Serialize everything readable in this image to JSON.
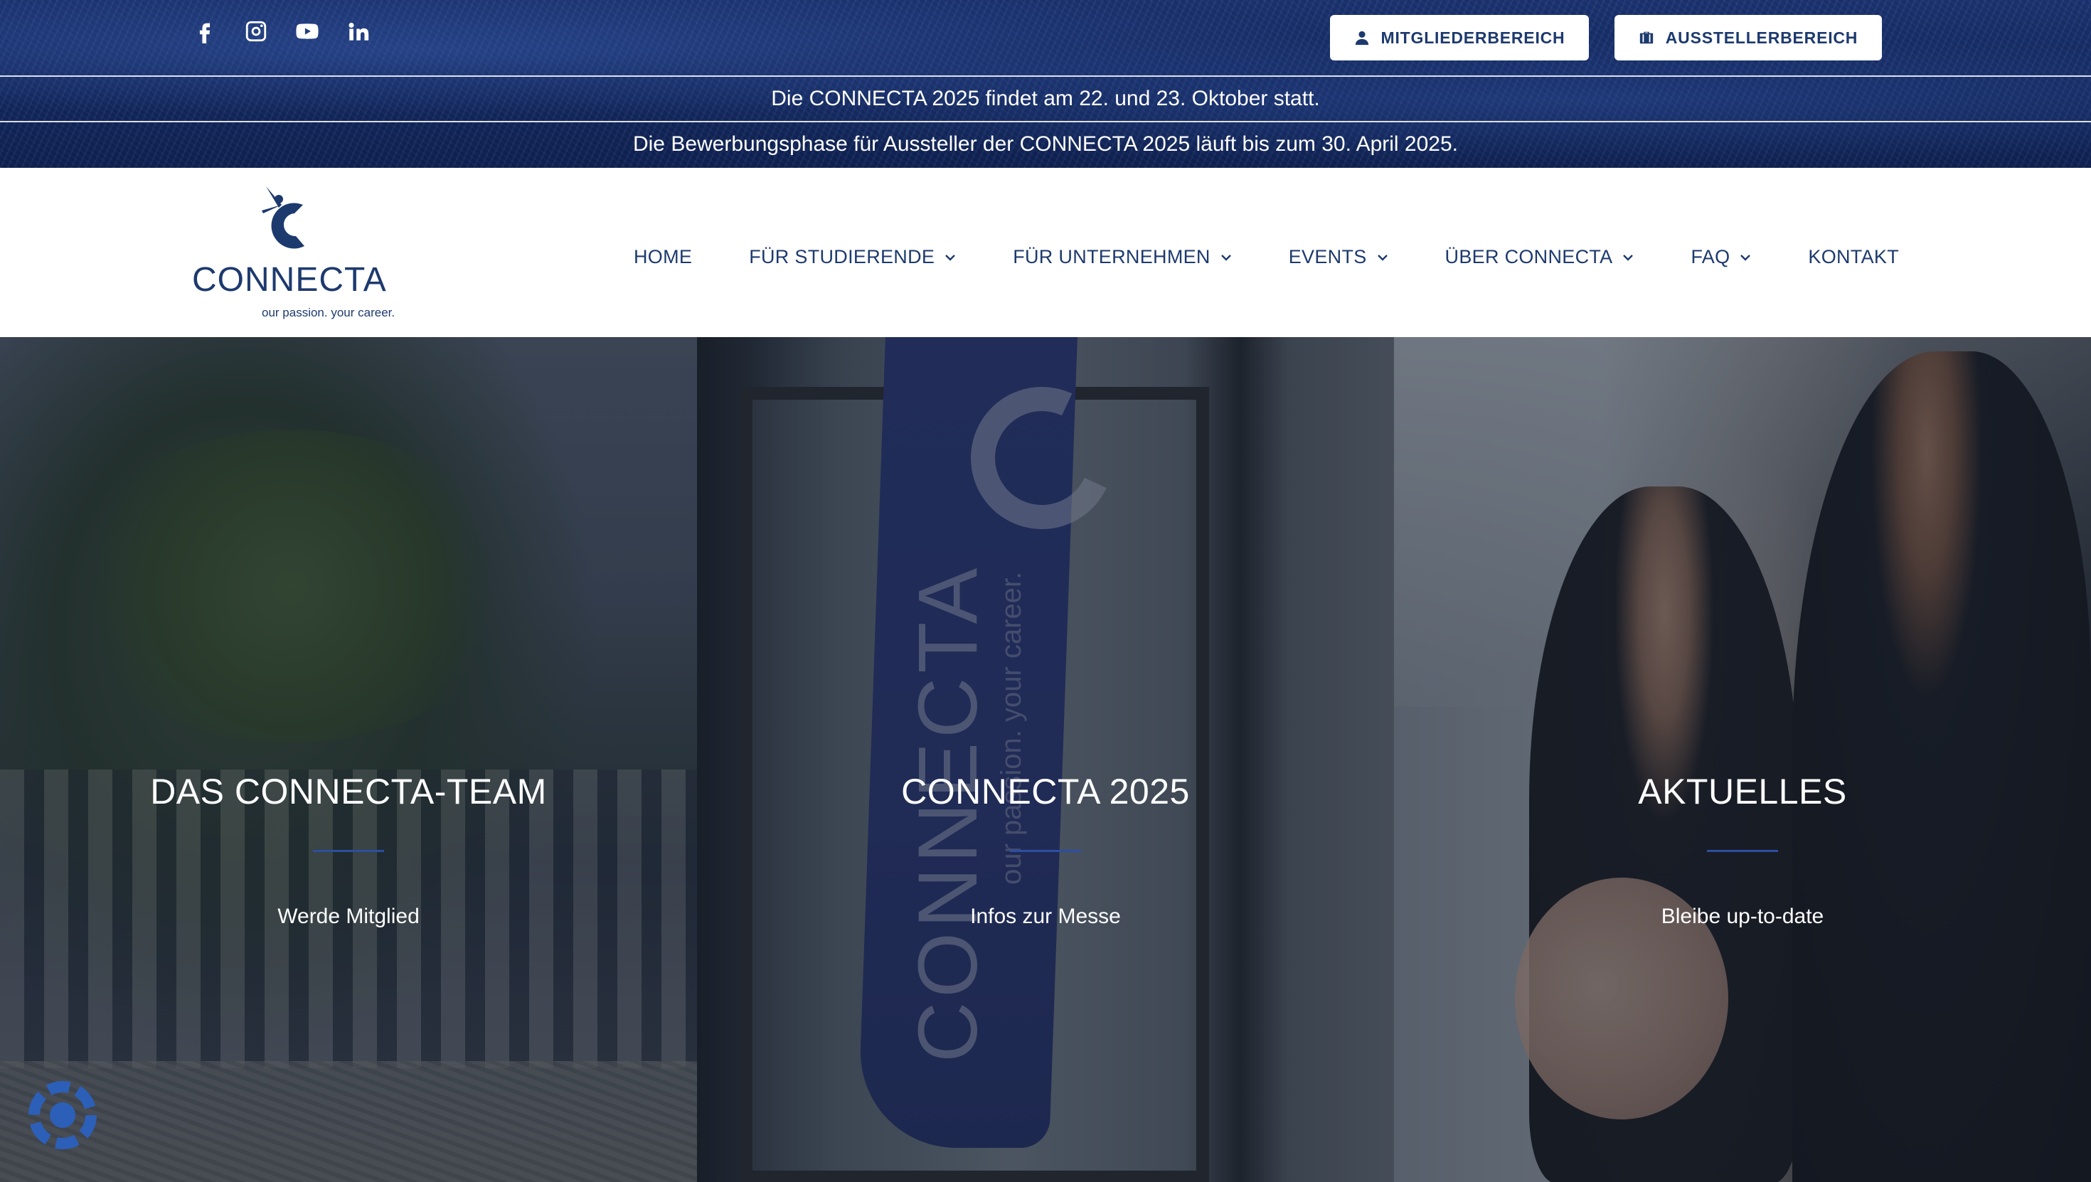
{
  "social": {
    "icons": [
      "facebook-icon",
      "instagram-icon",
      "youtube-icon",
      "linkedin-icon"
    ]
  },
  "top_buttons": {
    "members": {
      "label": "MITGLIEDERBEREICH",
      "icon": "user-icon"
    },
    "exhibitors": {
      "label": "AUSSTELLERBEREICH",
      "icon": "briefcase-icon"
    }
  },
  "notices": [
    "Die CONNECTA 2025 findet am 22. und 23. Oktober statt.",
    "Die Bewerbungsphase für Aussteller der CONNECTA 2025 läuft bis zum 30. April 2025."
  ],
  "logo": {
    "wordmark": "CONNECTA",
    "tagline": "our passion. your career."
  },
  "nav": {
    "items": [
      {
        "label": "HOME",
        "dropdown": false
      },
      {
        "label": "FÜR STUDIERENDE",
        "dropdown": true
      },
      {
        "label": "FÜR UNTERNEHMEN",
        "dropdown": true
      },
      {
        "label": "EVENTS",
        "dropdown": true
      },
      {
        "label": "ÜBER CONNECTA",
        "dropdown": true
      },
      {
        "label": "FAQ",
        "dropdown": true
      },
      {
        "label": "KONTAKT",
        "dropdown": false
      }
    ]
  },
  "panels": [
    {
      "title": "DAS CONNECTA-TEAM",
      "subtitle": "Werde Mitglied"
    },
    {
      "title": "CONNECTA 2025",
      "subtitle": "Infos zur Messe"
    },
    {
      "title": "AKTUELLES",
      "subtitle": "Bleibe up-to-date"
    }
  ],
  "flag": {
    "wordmark": "CONNECTA",
    "tagline": "our passion. your career."
  },
  "colors": {
    "brand_navy": "#1d3a6e",
    "accent_blue": "#2c4fa0",
    "topbar_blue": "#142a63"
  }
}
